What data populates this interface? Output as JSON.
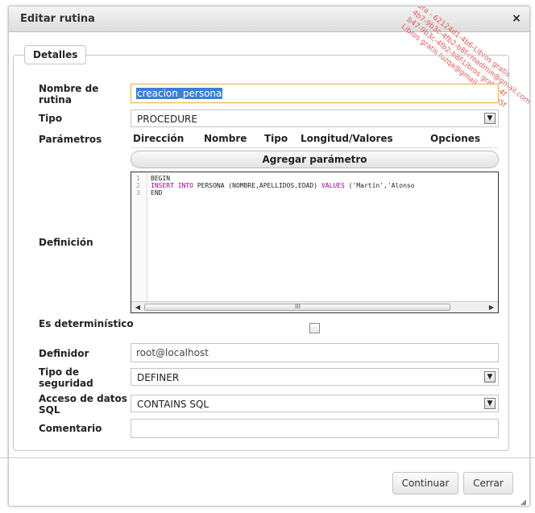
{
  "dialog": {
    "title": "Editar rutina",
    "close_glyph": "×",
    "watermark_lines": [
      "ara - 62124d1-4b6-Libros gratis",
      "4b7-9b3c-4fb2-b8f-rmadmin@gmail.com",
      "b47-9b3c-4fb2-b8f-Libros gratis 4f",
      "Libros gratis luzqa@gmail.com 7b5f"
    ]
  },
  "details": {
    "legend": "Detalles",
    "name_label": "Nombre de rutina",
    "name_value": "creacion_persona",
    "type_label": "Tipo",
    "type_value": "PROCEDURE",
    "params_label": "Parámetros",
    "params_columns": [
      "Dirección",
      "Nombre",
      "Tipo",
      "Longitud/Valores",
      "Opciones"
    ],
    "add_param_label": "Agregar parámetro",
    "definition_label": "Definición",
    "code_lines": [
      {
        "n": "1",
        "text": "BEGIN"
      },
      {
        "n": "2",
        "text": "INSERT INTO PERSONA (NOMBRE,APELLIDOS,EDAD) VALUES ('Martín','Alonso"
      },
      {
        "n": "3",
        "text": "END"
      }
    ],
    "deterministic_label": "Es determinístico",
    "deterministic_checked": false,
    "definer_label": "Definidor",
    "definer_value": "root@localhost",
    "security_label": "Tipo de seguridad",
    "security_value": "DEFINER",
    "sql_access_label": "Acceso de datos SQL",
    "sql_access_value": "CONTAINS SQL",
    "comment_label": "Comentario",
    "comment_value": ""
  },
  "footer": {
    "continue_label": "Continuar",
    "close_label": "Cerrar"
  },
  "icons": {
    "dropdown": "chevron-down-icon",
    "close": "close-icon",
    "scroll_left": "arrow-left-icon",
    "scroll_right": "arrow-right-icon",
    "resize": "resize-grip-icon"
  },
  "colors": {
    "focus_border": "#e8b955",
    "selection": "#3b7fd6",
    "keyword": "#990099"
  }
}
